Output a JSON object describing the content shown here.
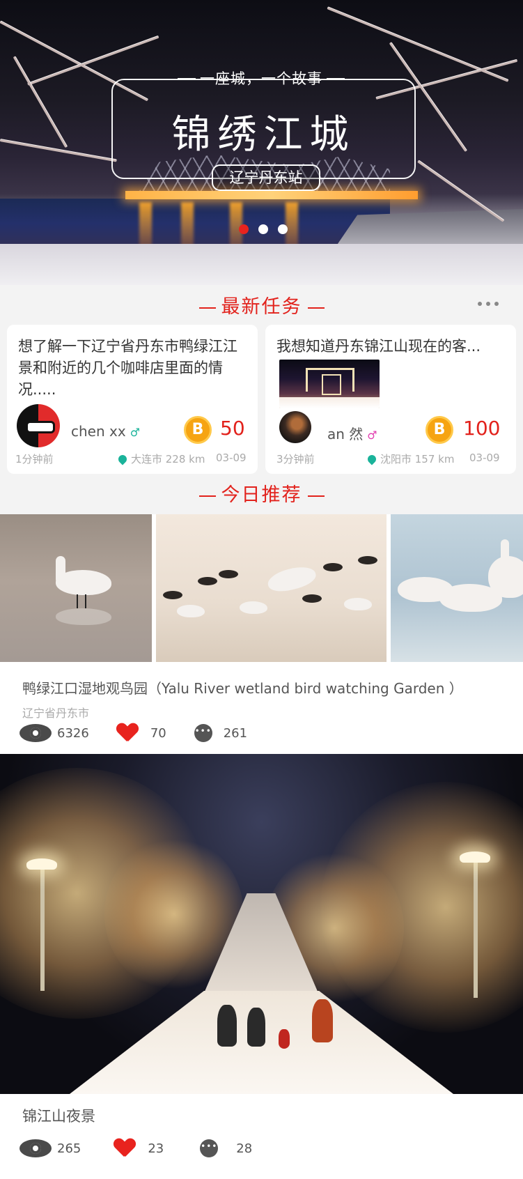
{
  "hero": {
    "tagline": "一座城，一个故事",
    "title": "锦绣江城",
    "station": "辽宁丹东站",
    "carousel_count": 3,
    "carousel_active": 0
  },
  "sections": {
    "tasks_title": "最新任务",
    "recommend_title": "今日推荐"
  },
  "tasks": [
    {
      "text": "想了解一下辽宁省丹东市鸭绿江江景和附近的几个咖啡店里面的情况.....",
      "user": "chen xx",
      "gender": "♂",
      "reward": "50",
      "coin_symbol": "B",
      "time": "1分钟前",
      "location": "大连市 228 km",
      "date": "03-09"
    },
    {
      "text": "我想知道丹东锦江山现在的客...",
      "user": "an 然",
      "gender": "♂",
      "reward": "100",
      "coin_symbol": "B",
      "time": "3分钟前",
      "location": "沈阳市 157 km",
      "date": "03-09"
    }
  ],
  "recommend": [
    {
      "title": "鸭绿江口湿地观鸟园（Yalu River wetland bird watching Garden ）",
      "location": "辽宁省丹东市",
      "views": "6326",
      "likes": "70",
      "comments": "261"
    },
    {
      "title": "锦江山夜景",
      "views": "265",
      "likes": "23",
      "comments": "28"
    }
  ],
  "colors": {
    "accent": "#e2221c",
    "coin": "#f6a412",
    "male": "#1ab39a",
    "female": "#e23fb0"
  },
  "icons": [
    "eye-icon",
    "heart-icon",
    "comment-icon",
    "location-pin-icon",
    "coin-icon",
    "more-icon"
  ]
}
